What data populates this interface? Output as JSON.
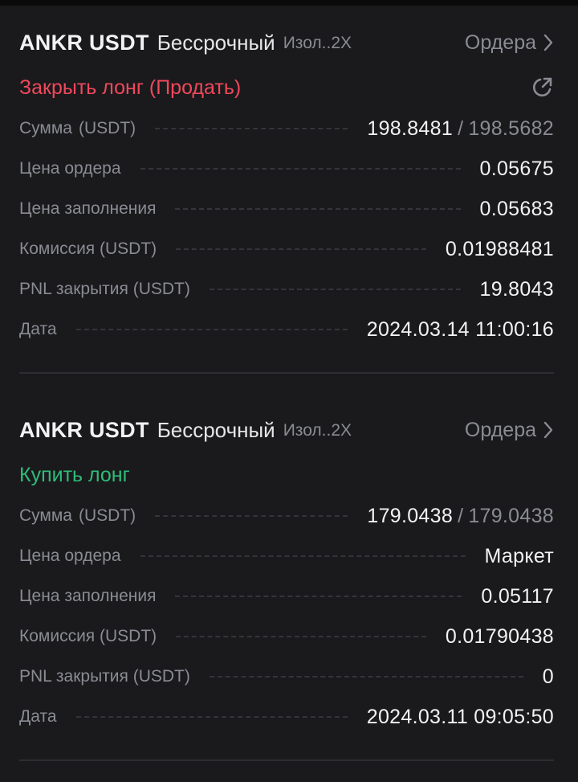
{
  "orders": [
    {
      "symbol": "ANKR USDT",
      "contract_type": "Бессрочный",
      "margin_mode": "Изол..2X",
      "orders_link": "Ордера",
      "action": "Закрыть лонг (Продать)",
      "action_color": "#f0485c",
      "amount_label": "Сумма",
      "amount_unit": "(USDT)",
      "amount_filled": "198.8481",
      "amount_separator": "/",
      "amount_total": "198.5682",
      "order_price_label": "Цена ордера",
      "order_price": "0.05675",
      "fill_price_label": "Цена заполнения",
      "fill_price": "0.05683",
      "fee_label": "Комиссия (USDT)",
      "fee": "0.01988481",
      "pnl_label": "PNL закрытия (USDT)",
      "pnl": "19.8043",
      "date_label": "Дата",
      "date": "2024.03.14 11:00:16"
    },
    {
      "symbol": "ANKR USDT",
      "contract_type": "Бессрочный",
      "margin_mode": "Изол..2X",
      "orders_link": "Ордера",
      "action": "Купить лонг",
      "action_color": "#2ebd7a",
      "amount_label": "Сумма",
      "amount_unit": "(USDT)",
      "amount_filled": "179.0438",
      "amount_separator": "/",
      "amount_total": "179.0438",
      "order_price_label": "Цена ордера",
      "order_price": "Маркет",
      "fill_price_label": "Цена заполнения",
      "fill_price": "0.05117",
      "fee_label": "Комиссия (USDT)",
      "fee": "0.01790438",
      "pnl_label": "PNL закрытия (USDT)",
      "pnl": "0",
      "date_label": "Дата",
      "date": "2024.03.11 09:05:50"
    }
  ],
  "icons": {
    "orders_chevron": "chevron-right-icon",
    "share": "share-icon"
  }
}
